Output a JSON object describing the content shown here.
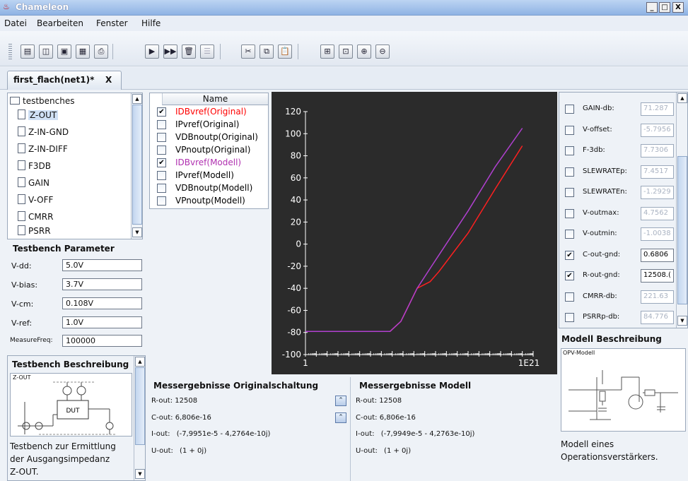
{
  "window": {
    "title": "Chameleon",
    "min": "_",
    "max": "□",
    "close": "X"
  },
  "menu": [
    "Datei",
    "Bearbeiten",
    "Fenster",
    "Hilfe"
  ],
  "toolbar": {
    "icons": [
      "new-document-icon",
      "open-icon",
      "save-icon",
      "save-all-icon",
      "print-icon",
      "run-icon",
      "run-all-icon",
      "delete-icon",
      "list-icon",
      "cut-icon",
      "copy-icon",
      "paste-icon",
      "layout-icon",
      "fit-icon",
      "zoom-in-icon",
      "zoom-out-icon"
    ]
  },
  "tab": {
    "label": "first_flach(net1)*",
    "close": "X"
  },
  "tree": {
    "root": "testbenches",
    "items": [
      "Z-OUT",
      "Z-IN-GND",
      "Z-IN-DIFF",
      "F3DB",
      "GAIN",
      "V-OFF",
      "CMRR",
      "PSRR"
    ],
    "selected": "Z-OUT"
  },
  "testbench_params": {
    "title": "Testbench Parameter",
    "rows": [
      {
        "label": "V-dd:",
        "value": "5.0V"
      },
      {
        "label": "V-bias:",
        "value": "3.7V"
      },
      {
        "label": "V-cm:",
        "value": "0.108V"
      },
      {
        "label": "V-ref:",
        "value": "1.0V"
      },
      {
        "label": "MeasureFreq:",
        "value": "100000"
      }
    ]
  },
  "testbench_desc": {
    "title": "Testbench Beschreibung",
    "thumb_label": "Z-OUT",
    "dut_label": "DUT",
    "text_lines": [
      "Testbench zur Ermittlung",
      "der Ausgangsimpedanz",
      "Z-OUT."
    ]
  },
  "signals": {
    "header": "Name",
    "items": [
      {
        "name": "IDBvref(Original)",
        "checked": true,
        "color": "#ff0000"
      },
      {
        "name": "IPvref(Original)",
        "checked": false,
        "color": "#000000"
      },
      {
        "name": "VDBnoutp(Original)",
        "checked": false,
        "color": "#000000"
      },
      {
        "name": "VPnoutp(Original)",
        "checked": false,
        "color": "#000000"
      },
      {
        "name": "IDBvref(Modell)",
        "checked": true,
        "color": "#b030b0"
      },
      {
        "name": "IPvref(Modell)",
        "checked": false,
        "color": "#000000"
      },
      {
        "name": "VDBnoutp(Modell)",
        "checked": false,
        "color": "#000000"
      },
      {
        "name": "VPnoutp(Modell)",
        "checked": false,
        "color": "#000000"
      }
    ]
  },
  "chart_data": {
    "type": "line",
    "x_scale": "log",
    "x_tick_labels": [
      "1",
      "1E21"
    ],
    "y_ticks": [
      "120",
      "100",
      "80",
      "60",
      "40",
      "20",
      "0",
      "-20",
      "-40",
      "-60",
      "-80",
      "-100"
    ],
    "ylim": [
      -100,
      120
    ],
    "xlim_exp": [
      0,
      21
    ],
    "background": "#2b2b2b",
    "series": [
      {
        "name": "IDBvref(Original)",
        "color": "#ff2020",
        "x_exp": [
          0,
          7.8,
          8.8,
          9.3,
          10.3,
          11.5,
          12.3,
          15,
          17.5,
          20
        ],
        "y": [
          -79,
          -79,
          -70,
          -60,
          -40,
          -34,
          -25,
          10,
          50,
          89
        ]
      },
      {
        "name": "IDBvref(Modell)",
        "color": "#b040d0",
        "x_exp": [
          0,
          7.8,
          8.8,
          9.3,
          10.3,
          11.5,
          12.3,
          15,
          17.5,
          20
        ],
        "y": [
          -79,
          -79,
          -70,
          -60,
          -40,
          -22,
          -10,
          30,
          70,
          105
        ]
      }
    ]
  },
  "results_original": {
    "title": "Messergebnisse Originalschaltung",
    "rows": [
      {
        "label": "R-out:",
        "value": "12508"
      },
      {
        "label": "C-out:",
        "value": "6,806e-16"
      },
      {
        "label": "I-out:",
        "value": "(-7,9951e-5 - 4,2764e-10j)"
      },
      {
        "label": "U-out:",
        "value": "(1 + 0j)"
      }
    ]
  },
  "results_model": {
    "title": "Messergebnisse Modell",
    "rows": [
      {
        "label": "R-out:",
        "value": "12508"
      },
      {
        "label": "C-out:",
        "value": "6,806e-16"
      },
      {
        "label": "I-out:",
        "value": "(-7,9949e-5 - 4,2763e-10j)"
      },
      {
        "label": "U-out:",
        "value": "(1 + 0j)"
      }
    ]
  },
  "model_params": [
    {
      "label": "GAIN-db:",
      "value": "71.287",
      "checked": false
    },
    {
      "label": "V-offset:",
      "value": "-5.7956",
      "checked": false
    },
    {
      "label": "F-3db:",
      "value": "7.7306",
      "checked": false
    },
    {
      "label": "SLEWRATEp:",
      "value": "7.4517",
      "checked": false
    },
    {
      "label": "SLEWRATEn:",
      "value": "-1.2929",
      "checked": false
    },
    {
      "label": "V-outmax:",
      "value": "4.7562",
      "checked": false
    },
    {
      "label": "V-outmin:",
      "value": "-1.0038",
      "checked": false
    },
    {
      "label": "C-out-gnd:",
      "value": "0.6806",
      "checked": true
    },
    {
      "label": "R-out-gnd:",
      "value": "12508.(",
      "checked": true
    },
    {
      "label": "CMRR-db:",
      "value": "221.63",
      "checked": false
    },
    {
      "label": "PSRRp-db:",
      "value": "84.776",
      "checked": false
    }
  ],
  "model_desc": {
    "title": "Modell Beschreibung",
    "thumb_label": "OPV-Modell",
    "text_lines": [
      "Modell eines",
      "Operationsverstärkers."
    ]
  }
}
